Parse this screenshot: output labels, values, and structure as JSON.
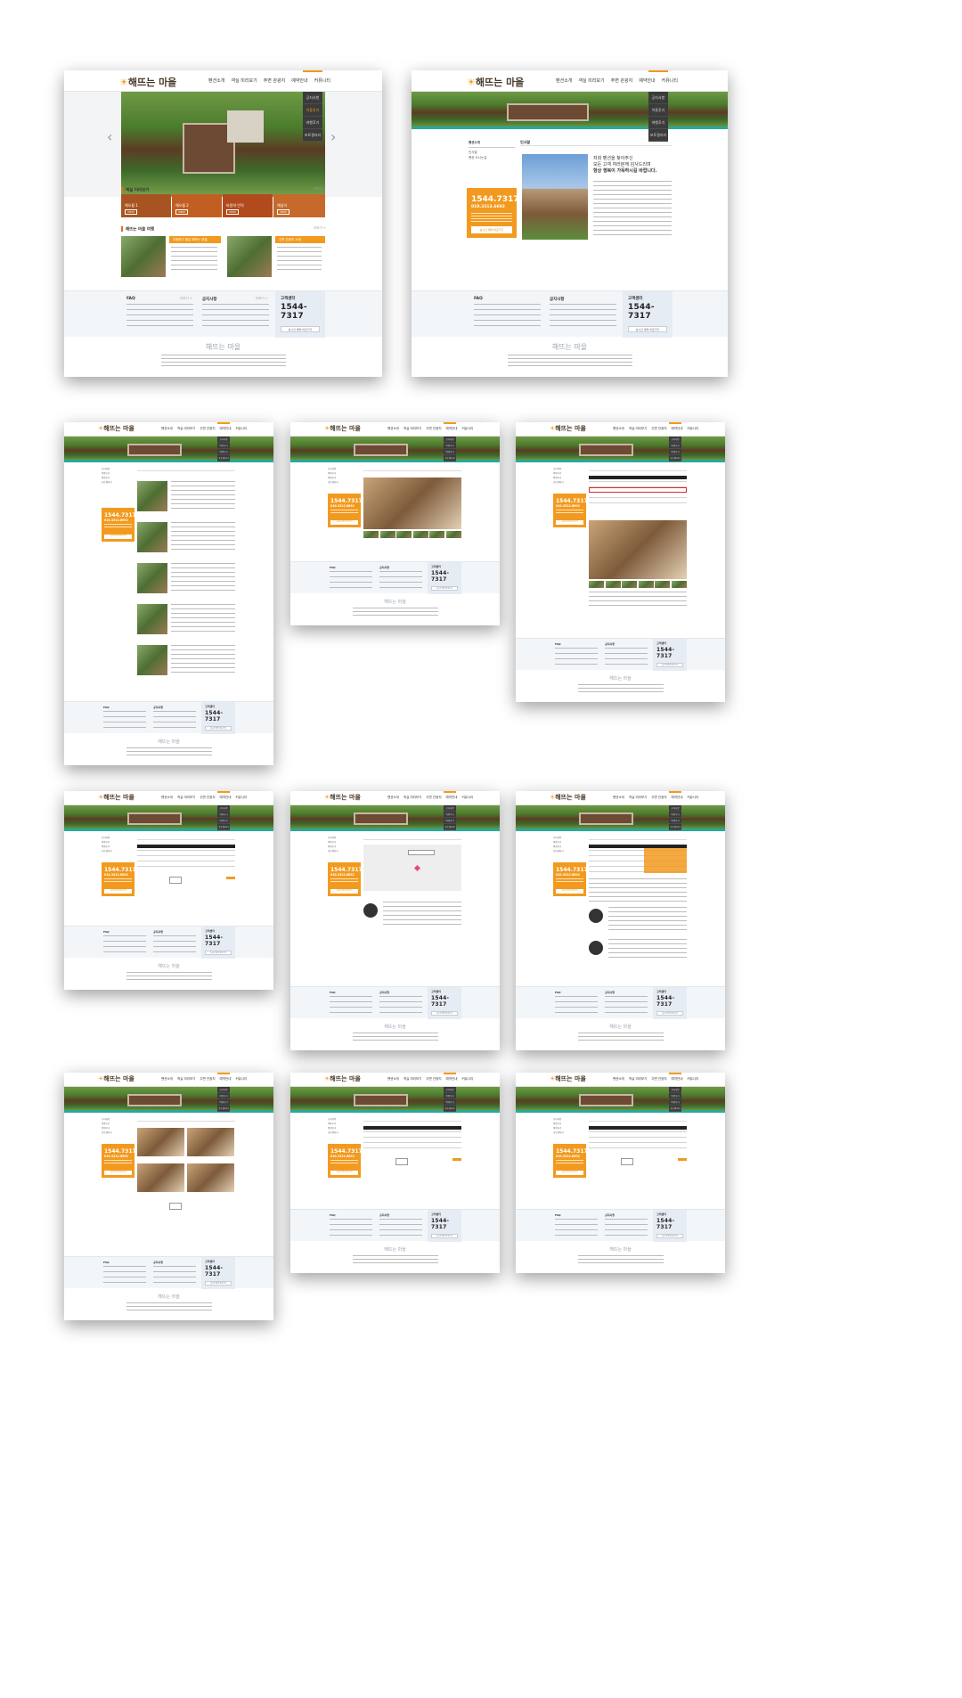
{
  "brand": {
    "logo_text": "해뜨는 마을",
    "accent_color": "#f29a1f",
    "dark_color": "#3b3b3b",
    "teal_color": "#2aa89a"
  },
  "nav": {
    "items": [
      "펜션소개",
      "객실 미리보기",
      "주변 관광지",
      "예약안내",
      "커뮤니티"
    ]
  },
  "submenu": {
    "items": [
      "공지사항",
      "이용후기",
      "여행후기",
      "포토갤러리"
    ]
  },
  "home": {
    "rooms_title": "객실 미리보기",
    "more": "더보기 +",
    "room_tiles": [
      "해오름 1",
      "해오름 2",
      "바람의 언덕",
      "해넘이"
    ],
    "story_title": "해뜨는 마을 여행",
    "story_cards": [
      "여행하기 좋은 해뜨는 마을",
      "주변 관광지 소개"
    ]
  },
  "intro": {
    "side_title": "펜션소개",
    "side_items": [
      "인사말",
      "펜션 오시는길"
    ],
    "page_title": "인사말",
    "headline_1": "저희 펜션을 찾아주신",
    "headline_2": "모든 고객 여러분께 감사드리며",
    "headline_3": "항상 행복이 가득하시길 바랍니다."
  },
  "contact": {
    "phone_main": "1544.7317",
    "phone_sub": "010.3312.6692",
    "reserve_btn": "실시간 예약 바로가기"
  },
  "footer": {
    "faq_title": "FAQ",
    "notice_title": "공지사항",
    "cs_title": "고객센터",
    "cs_phone": "1544-7317",
    "cs_btn": "실시간 예약 바로가기",
    "more": "더보기 +",
    "logo": "해뜨는 마을"
  }
}
